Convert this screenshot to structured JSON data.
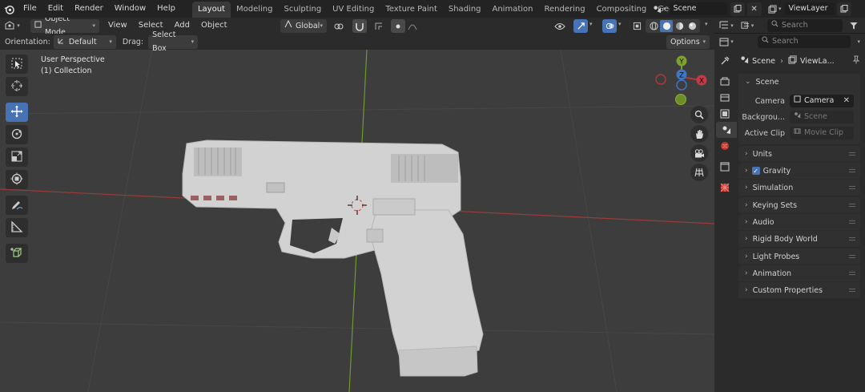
{
  "topbar": {
    "menu": [
      "File",
      "Edit",
      "Render",
      "Window",
      "Help"
    ],
    "workspaces": [
      "Layout",
      "Modeling",
      "Sculpting",
      "UV Editing",
      "Texture Paint",
      "Shading",
      "Animation",
      "Rendering",
      "Compositing",
      "Geometry Node"
    ],
    "active_workspace": "Layout",
    "scene_name": "Scene",
    "view_layer": "ViewLayer"
  },
  "viewport_header": {
    "mode": "Object Mode",
    "menus": [
      "View",
      "Select",
      "Add",
      "Object"
    ],
    "transform_orientation": "Global"
  },
  "viewport_header2": {
    "orientation_label": "Orientation:",
    "orientation_value": "Default",
    "drag_label": "Drag:",
    "drag_value": "Select Box",
    "options_label": "Options"
  },
  "viewport": {
    "perspective": "User Perspective",
    "collection": "(1) Collection",
    "gizmo": {
      "y": "Y",
      "z": "Z",
      "x": "X"
    }
  },
  "properties": {
    "search_placeholder": "Search",
    "outliner_search_placeholder": "Search",
    "breadcrumb_scene": "Scene",
    "breadcrumb_layer": "ViewLa...",
    "scene_panel_title": "Scene",
    "camera_label": "Camera",
    "camera_value": "Camera",
    "background_label": "Backgrou...",
    "background_placeholder": "Scene",
    "active_clip_label": "Active Clip",
    "active_clip_placeholder": "Movie Clip",
    "panels": [
      "Units",
      "Gravity",
      "Simulation",
      "Keying Sets",
      "Audio",
      "Rigid Body World",
      "Light Probes",
      "Animation",
      "Custom Properties"
    ],
    "gravity_checked": true
  },
  "colors": {
    "accent": "#4772b3",
    "axis_x": "#b03a3a",
    "axis_y": "#7ea02d",
    "viewport_bg": "#3d3d3d"
  }
}
